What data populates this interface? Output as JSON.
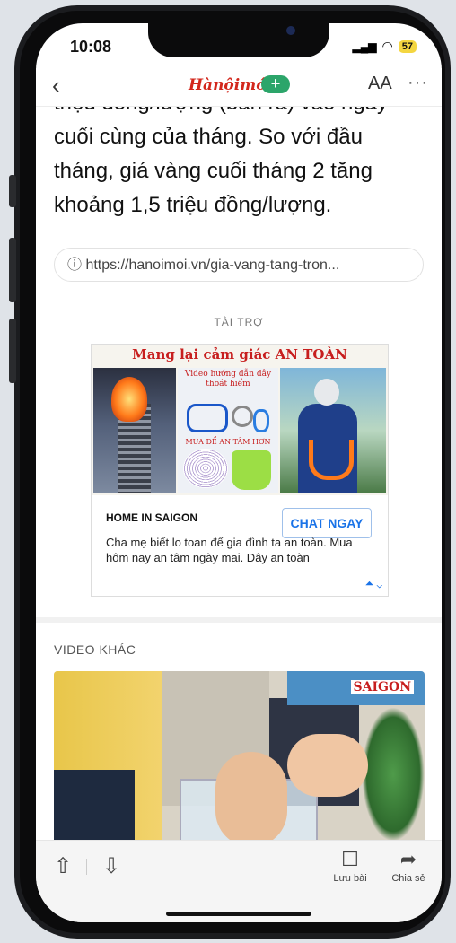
{
  "status": {
    "time": "10:08",
    "battery": "57"
  },
  "topbar": {
    "back": "‹",
    "brand": "Hànộimới",
    "plus": "+",
    "font_size": "AA",
    "more": "···"
  },
  "article": {
    "paragraph": "triệu đồng/lượng (bán ra) vào ngày cuối cùng của tháng. So với đầu tháng, giá vàng cuối tháng 2 tăng khoảng 1,5 triệu đồng/lượng.",
    "source_url": "ⓘ https://hanoimoi.vn/gia-vang-tang-tron..."
  },
  "sponsor": {
    "label": "TÀI TRỢ",
    "ad": {
      "headline": "Mang lại cảm giác AN TOÀN",
      "video_caption": "Video hướng dẫn dây thoát hiểm",
      "buy_caption": "MUA ĐỂ AN TÂM HƠN",
      "advertiser": "HOME IN SAIGON",
      "cta": "CHAT NGAY",
      "text": "Cha mẹ biết lo toan để gia đình ta an toàn. Mua hôm nay an tâm ngày mai. Dây an toàn",
      "choices": "⏶ ⌄"
    }
  },
  "video": {
    "label": "VIDEO KHÁC",
    "logo": "SAIGON"
  },
  "bottombar": {
    "up": "⇧",
    "down": "⇩",
    "save_icon": "☐",
    "save": "Lưu bài",
    "share_icon": "➦",
    "share": "Chia sẻ"
  }
}
